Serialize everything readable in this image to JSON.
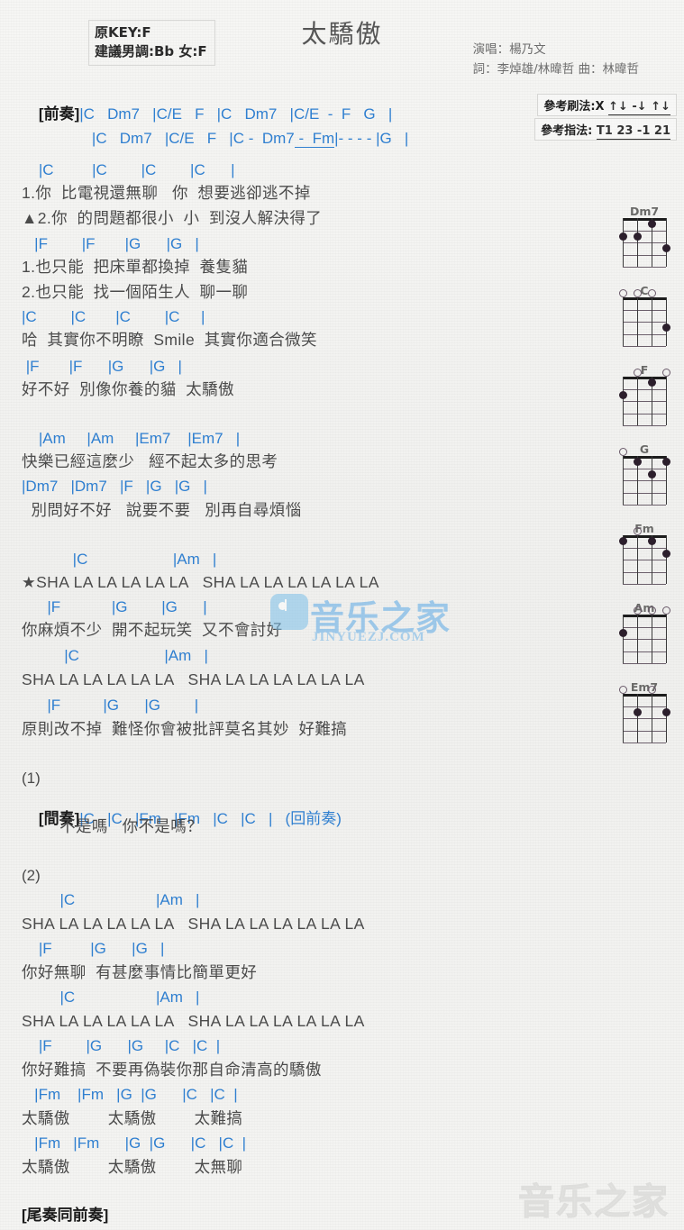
{
  "header": {
    "title": "太驕傲",
    "key_orig": "原KEY:F",
    "key_suggest": "建議男調:Bb 女:F",
    "singer": "演唱：楊乃文",
    "writers": "詞：李焯雄/林暐哲  曲：林暐哲"
  },
  "reference": {
    "strum_label": "參考刷法:X",
    "strum_pattern": "↑↓ -↓ ↑↓",
    "fingering_label": "參考指法:",
    "fingering_pattern": "T1 23 -1 21"
  },
  "intro": {
    "label": "[前奏]",
    "line1": "|C   Dm7   |C/E   F   |C   Dm7   |C/E  -  F   G   |",
    "line2": "|C   Dm7   |C/E   F   |C -  Dm7",
    "line2b": " -  Fm",
    "line2c": "|- - - - |G   |"
  },
  "sections": [
    {
      "chords": "    |C         |C        |C        |C      |",
      "lyrics": [
        "1.你  比電視還無聊   你  想要逃卻逃不掉",
        "▲2.你  的問題都很小  小  到沒人解決得了"
      ]
    },
    {
      "chords": "   |F        |F       |G      |G   |",
      "lyrics": [
        "1.也只能  把床單都換掉  養隻貓",
        "2.也只能  找一個陌生人  聊一聊"
      ]
    },
    {
      "chords": "|C        |C       |C        |C     |",
      "lyrics": [
        "哈  其實你不明瞭  Smile  其實你適合微笑"
      ]
    },
    {
      "chords": " |F       |F      |G      |G   |",
      "lyrics": [
        "好不好  別像你養的貓  太驕傲"
      ]
    },
    {
      "chords": "    |Am     |Am     |Em7    |Em7   |",
      "lyrics": [
        "快樂已經這麼少   經不起太多的思考"
      ]
    },
    {
      "chords": "|Dm7   |Dm7   |F   |G   |G   |",
      "lyrics": [
        "  別問好不好   說要不要   別再自尋煩惱"
      ]
    },
    {
      "chords": "            |C                    |Am   |",
      "lyrics": [
        "★SHA LA LA LA LA LA   SHA LA LA LA LA LA LA"
      ]
    },
    {
      "chords": "      |F            |G        |G      |",
      "lyrics": [
        "你麻煩不少  開不起玩笑  又不會討好"
      ]
    },
    {
      "chords": "          |C                    |Am   |",
      "lyrics": [
        "SHA LA LA LA LA LA   SHA LA LA LA LA LA LA"
      ]
    },
    {
      "chords": "      |F          |G      |G        |",
      "lyrics": [
        "原則改不掉  難怪你會被批評莫名其妙  好難搞"
      ]
    }
  ],
  "interlude": {
    "marker": "(1)",
    "label": "[間奏]",
    "chords": "|C   |C   |Fm   |Fm   |C   |C   |   (回前奏)",
    "lyrics": "        不是嗎   你不是嗎？"
  },
  "section2": {
    "marker": "(2)",
    "blocks": [
      {
        "chords": "         |C                   |Am   |",
        "lyrics": "SHA LA LA LA LA LA   SHA LA LA LA LA LA LA"
      },
      {
        "chords": "    |F         |G      |G   |",
        "lyrics": "你好無聊  有甚麼事情比簡單更好"
      },
      {
        "chords": "         |C                   |Am   |",
        "lyrics": "SHA LA LA LA LA LA   SHA LA LA LA LA LA LA"
      },
      {
        "chords": "    |F        |G      |G     |C   |C  |",
        "lyrics": "你好難搞  不要再偽裝你那自命清高的驕傲"
      },
      {
        "chords": "   |Fm    |Fm   |G  |G      |C   |C  |",
        "lyrics": "太驕傲        太驕傲        太難搞"
      },
      {
        "chords": "   |Fm   |Fm      |G  |G      |C   |C  |",
        "lyrics": "太驕傲        太驕傲        太無聊"
      }
    ]
  },
  "outro": {
    "label": "[尾奏同前奏]"
  },
  "chord_diagrams": [
    {
      "name": "Dm7",
      "open": [],
      "dots": [
        {
          "s": 1,
          "f": 2
        },
        {
          "s": 2,
          "f": 2
        },
        {
          "s": 3,
          "f": 1
        },
        {
          "s": 4,
          "f": 3
        }
      ]
    },
    {
      "name": "C",
      "open": [
        1,
        2,
        3
      ],
      "dots": [
        {
          "s": 4,
          "f": 3
        }
      ]
    },
    {
      "name": "F",
      "open": [
        2,
        4
      ],
      "dots": [
        {
          "s": 1,
          "f": 2
        },
        {
          "s": 3,
          "f": 1
        }
      ]
    },
    {
      "name": "G",
      "open": [
        1
      ],
      "dots": [
        {
          "s": 2,
          "f": 1
        },
        {
          "s": 4,
          "f": 1
        },
        {
          "s": 3,
          "f": 2
        }
      ]
    },
    {
      "name": "Fm",
      "open": [
        2
      ],
      "dots": [
        {
          "s": 1,
          "f": 1
        },
        {
          "s": 3,
          "f": 1
        },
        {
          "s": 4,
          "f": 2
        }
      ]
    },
    {
      "name": "Am",
      "open": [
        2,
        3,
        4
      ],
      "dots": [
        {
          "s": 1,
          "f": 2
        }
      ]
    },
    {
      "name": "Em7",
      "open": [
        1,
        3
      ],
      "dots": [
        {
          "s": 2,
          "f": 2
        },
        {
          "s": 4,
          "f": 2
        }
      ]
    }
  ],
  "watermark": {
    "text": "音乐之家",
    "sub": "JINYUEZJ.COM",
    "bottom": "音乐之家"
  },
  "colors": {
    "chord": "#2f7fd0",
    "lyric": "#4b4b4b",
    "title": "#555555"
  }
}
